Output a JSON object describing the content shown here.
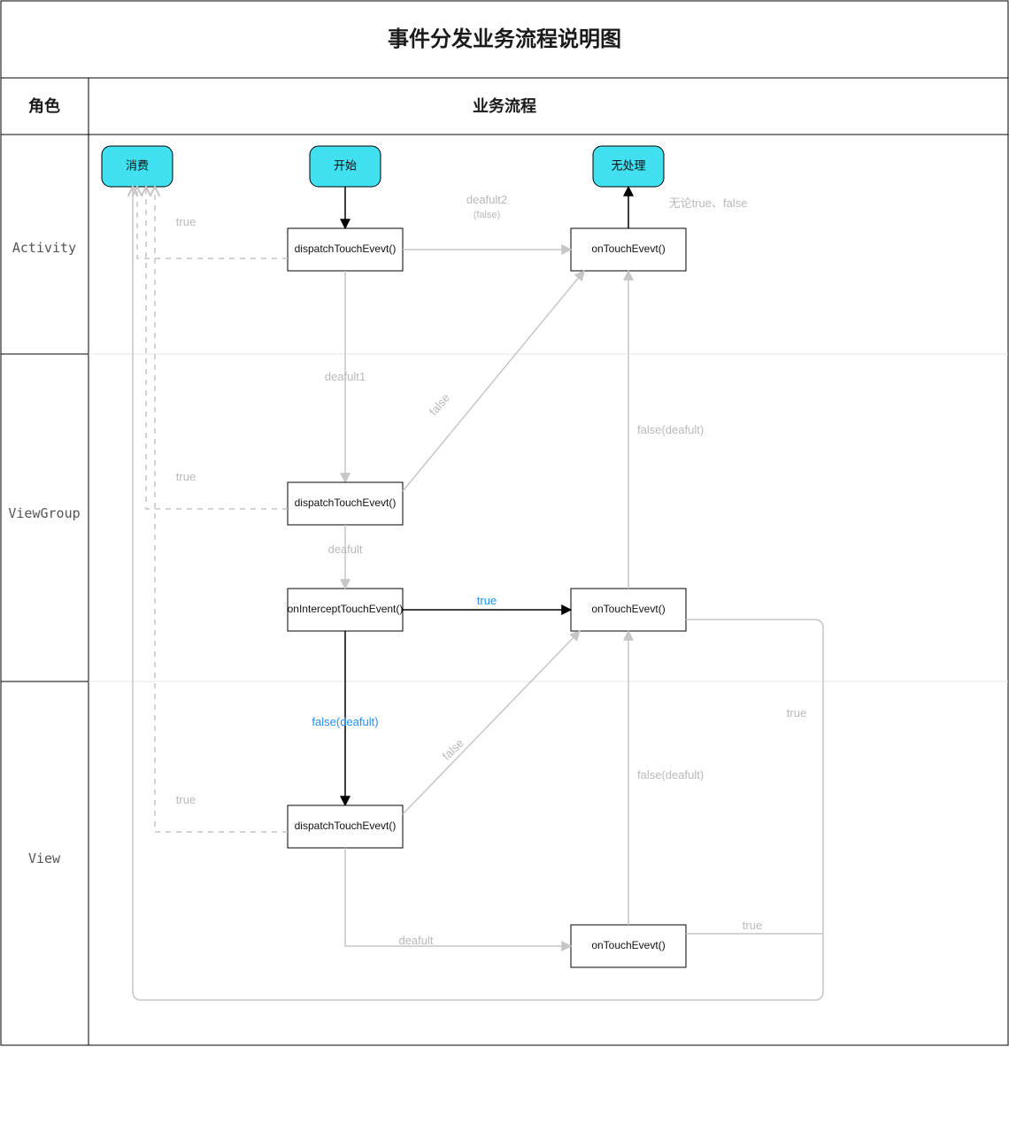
{
  "title": "事件分发业务流程说明图",
  "columns": {
    "role": "角色",
    "flow": "业务流程"
  },
  "rows": {
    "r1": "Activity",
    "r2": "ViewGroup",
    "r3": "View"
  },
  "terminals": {
    "consume": "消费",
    "start": "开始",
    "nohandle": "无处理"
  },
  "nodes": {
    "act_dispatch": "dispatchTouchEvevt()",
    "act_ontouch": "onTouchEvevt()",
    "vg_dispatch": "dispatchTouchEvevt()",
    "vg_intercept": "onInterceptTouchEvent()",
    "vg_ontouch": "onTouchEvevt()",
    "v_dispatch": "dispatchTouchEvevt()",
    "v_ontouch": "onTouchEvevt()"
  },
  "labels": {
    "true": "true",
    "deafult1": "deafult1",
    "deafult2": "deafult2",
    "deafult2_sub": "(false)",
    "nohandle_note": "无论true、false",
    "deafult": "deafult",
    "false": "false",
    "intercept_true": "true",
    "intercept_false": "false(deafult)",
    "false_deafult_up1": "false(deafult)",
    "false_deafult_up2": "false(deafult)",
    "view_true_right": "true"
  }
}
